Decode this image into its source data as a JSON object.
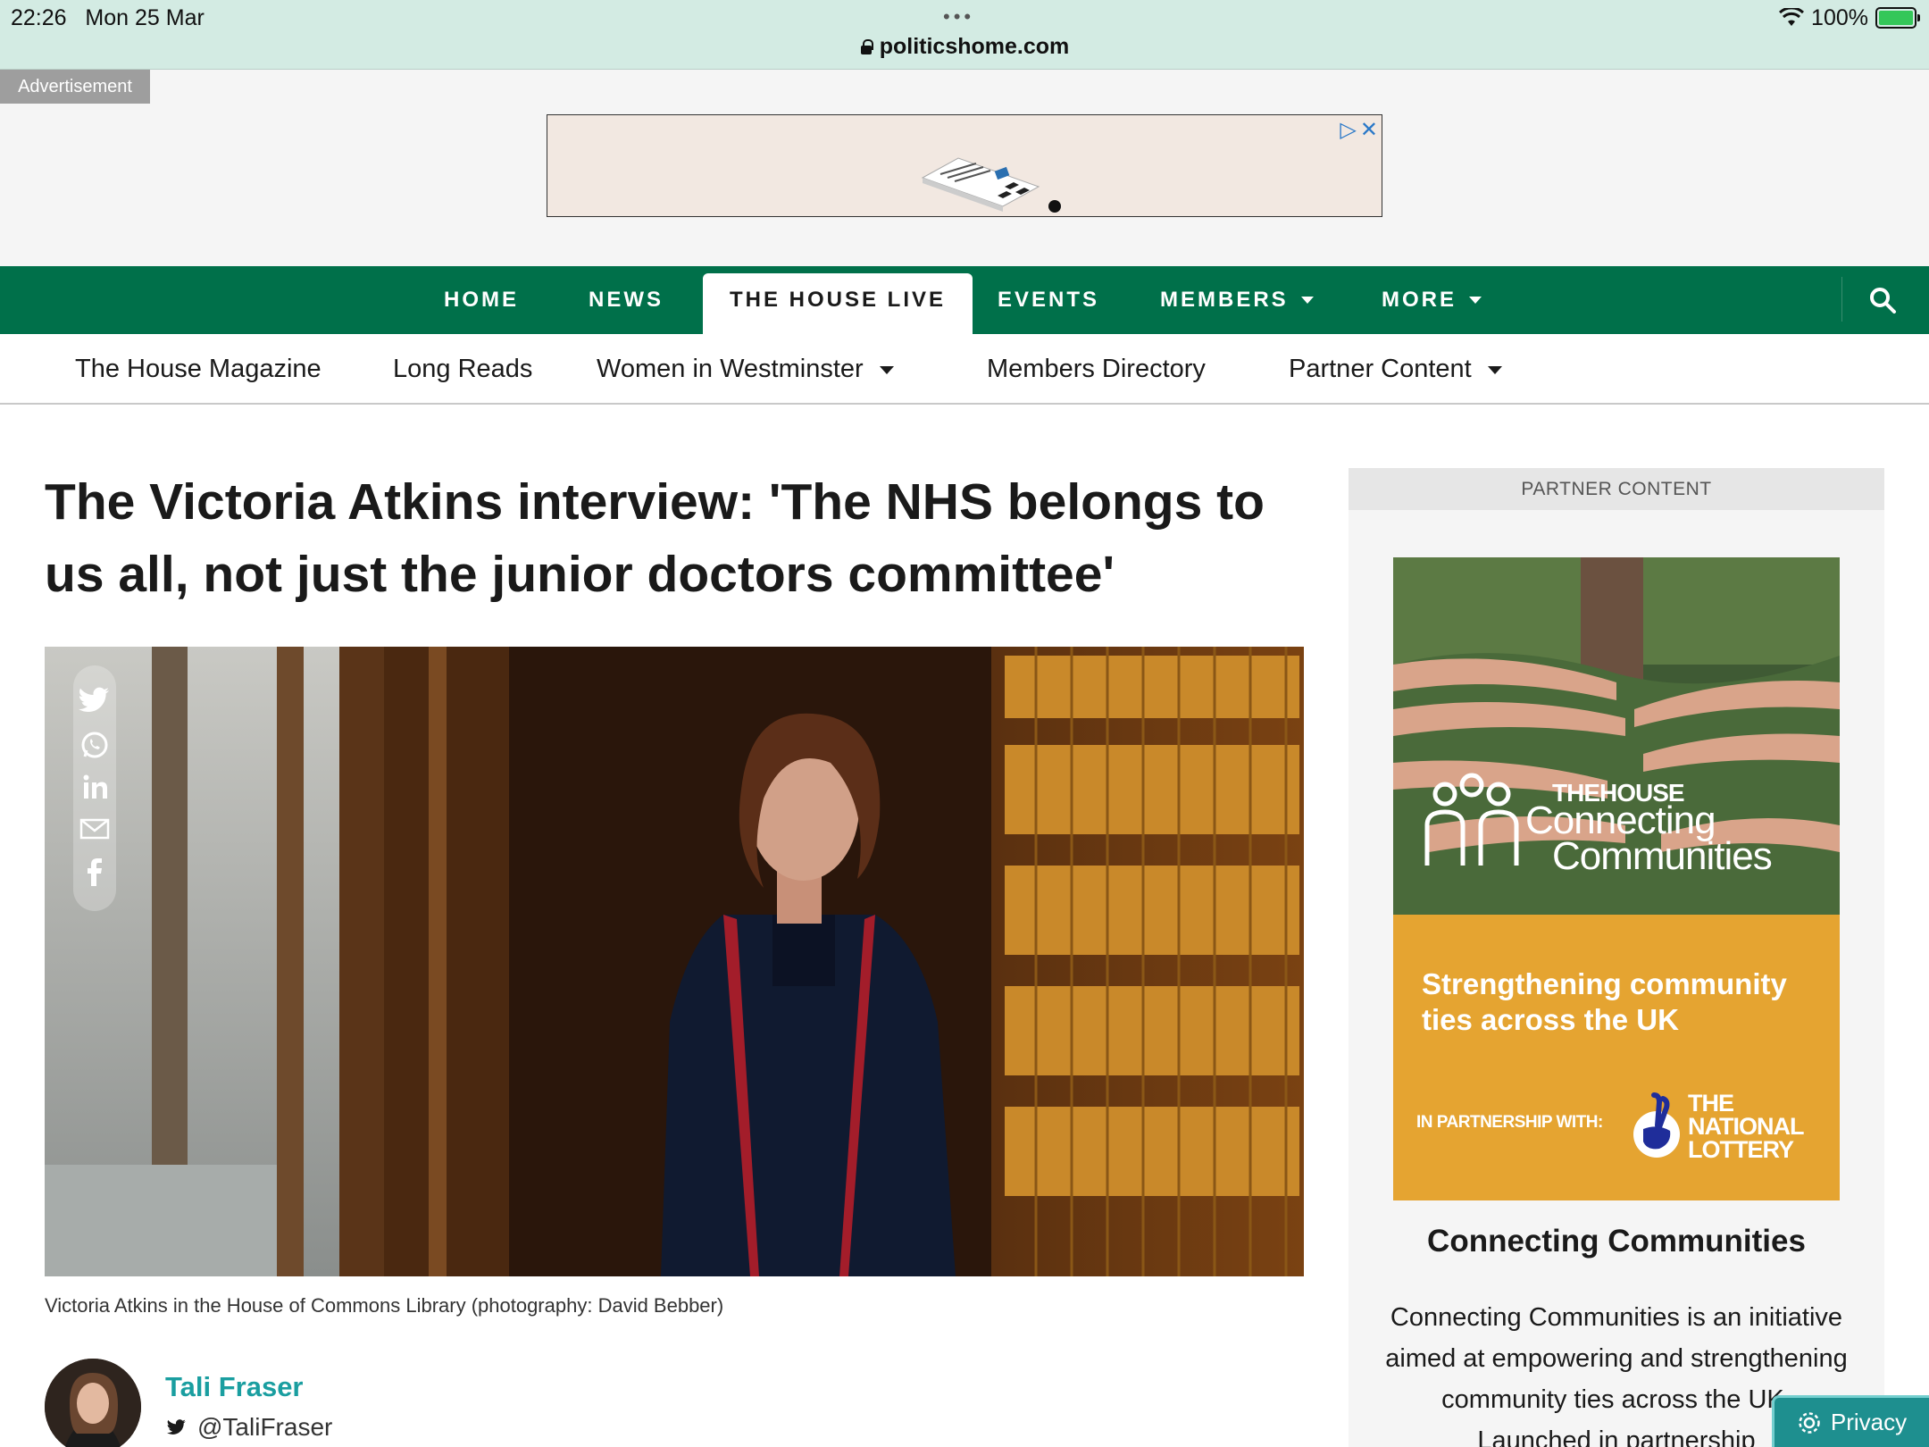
{
  "status_bar": {
    "time": "22:26",
    "date": "Mon 25 Mar",
    "url": "politicshome.com",
    "battery_percent": "100%"
  },
  "ad": {
    "label": "Advertisement"
  },
  "nav_main": {
    "items": [
      {
        "label": "HOME"
      },
      {
        "label": "NEWS"
      },
      {
        "label": "THE HOUSE LIVE"
      },
      {
        "label": "EVENTS"
      },
      {
        "label": "MEMBERS"
      },
      {
        "label": "MORE"
      }
    ],
    "active_color": "#00704a"
  },
  "nav_sub": {
    "items": [
      {
        "label": "The House Magazine"
      },
      {
        "label": "Long Reads"
      },
      {
        "label": "Women in Westminster"
      },
      {
        "label": "Members Directory"
      },
      {
        "label": "Partner Content"
      }
    ]
  },
  "article": {
    "headline": "The Victoria Atkins interview: 'The NHS belongs to us all, not just the junior doctors committee'",
    "caption": "Victoria Atkins in the House of Commons Library (photography: David Bebber)",
    "author": {
      "name": "Tali Fraser",
      "handle": "@TaliFraser"
    },
    "share_icons": [
      "twitter-icon",
      "whatsapp-icon",
      "linkedin-icon",
      "email-icon",
      "facebook-icon"
    ]
  },
  "sidebar": {
    "label": "PARTNER CONTENT",
    "promo": {
      "brand_small": "THEHOUSE",
      "brand_line1": "Connecting",
      "brand_line2": "Communities",
      "tagline": "Strengthening community ties across the UK",
      "partner_label": "IN PARTNERSHIP WITH:",
      "lottery_line1": "THE",
      "lottery_line2": "NATIONAL",
      "lottery_line3": "LOTTERY"
    },
    "title": "Connecting Communities",
    "body": "Connecting Communities is an initiative aimed at empowering and strengthening community ties across the UK. Launched in partnership"
  },
  "privacy_button": {
    "label": "Privacy"
  }
}
